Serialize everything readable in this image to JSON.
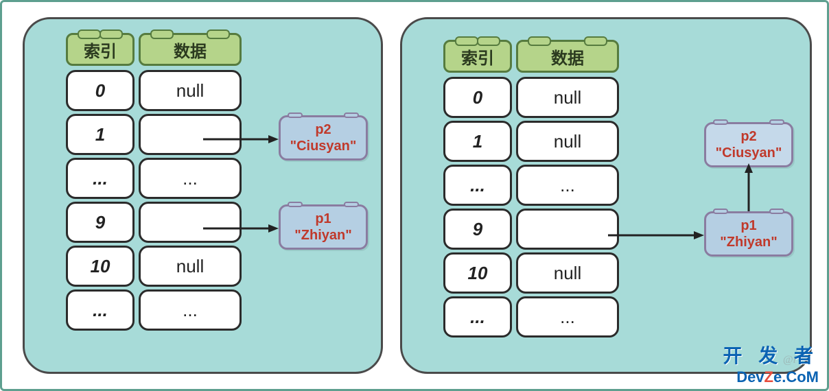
{
  "headers": {
    "index": "索引",
    "data": "数据"
  },
  "left_table": {
    "rows": [
      {
        "idx": "0",
        "data": "null"
      },
      {
        "idx": "1",
        "data": ""
      },
      {
        "idx": "...",
        "data": "..."
      },
      {
        "idx": "9",
        "data": ""
      },
      {
        "idx": "10",
        "data": "null"
      },
      {
        "idx": "...",
        "data": "..."
      }
    ],
    "pointers": {
      "from_index_1": {
        "label_line1": "p2",
        "label_line2": "\"Ciusyan\""
      },
      "from_index_9": {
        "label_line1": "p1",
        "label_line2": "\"Zhiyan\""
      }
    }
  },
  "right_table": {
    "rows": [
      {
        "idx": "0",
        "data": "null"
      },
      {
        "idx": "1",
        "data": "null"
      },
      {
        "idx": "...",
        "data": "..."
      },
      {
        "idx": "9",
        "data": ""
      },
      {
        "idx": "10",
        "data": "null"
      },
      {
        "idx": "...",
        "data": "..."
      }
    ],
    "pointers": {
      "from_index_9_to_p1": {
        "label_line1": "p1",
        "label_line2": "\"Zhiyan\""
      },
      "p1_to_p2": {
        "label_line1": "p2",
        "label_line2": "\"Ciusyan\""
      }
    }
  },
  "watermark": {
    "cn": "开 发 者",
    "en_pre": "Dev",
    "en_mid": "Z",
    "en_post": "e.CoM",
    "sig": "@i"
  }
}
